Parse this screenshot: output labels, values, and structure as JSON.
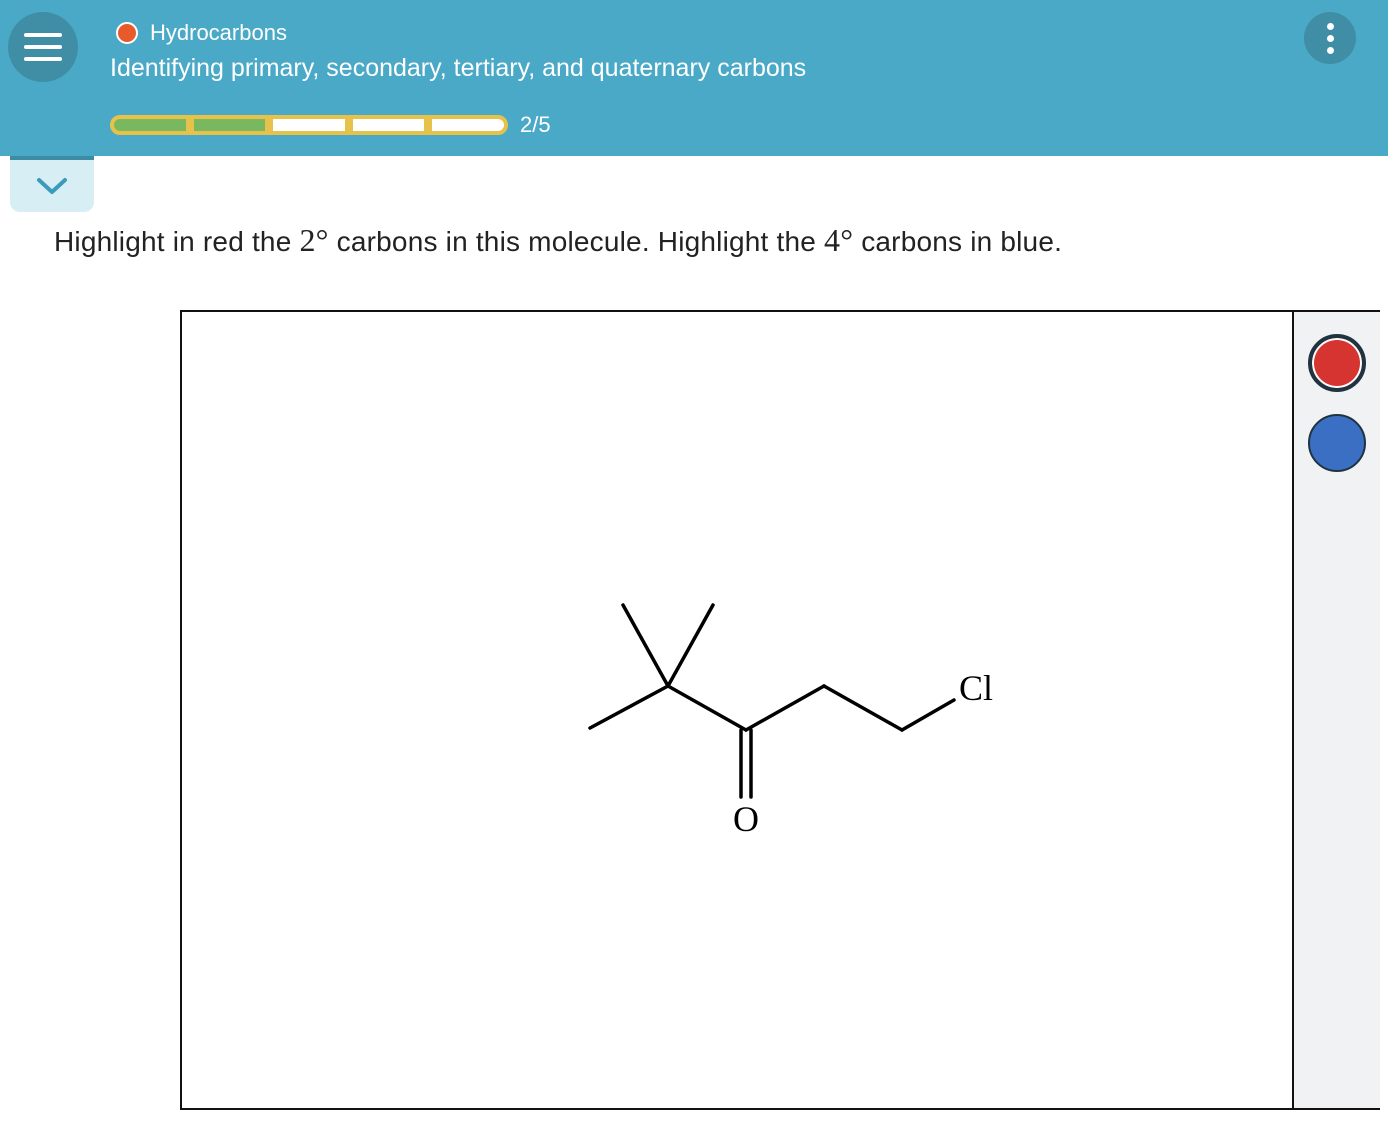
{
  "header": {
    "topic": "Hydrocarbons",
    "title": "Identifying primary, secondary, tertiary, and quaternary carbons",
    "progress": {
      "current": 2,
      "total": 5,
      "label": "2/5"
    }
  },
  "question": {
    "part1": "Highlight in red the ",
    "deg1": "2°",
    "part2": " carbons in this molecule. Highlight the ",
    "deg2": "4°",
    "part3": " carbons in blue."
  },
  "molecule": {
    "atom_cl": "Cl",
    "atom_o": "O"
  },
  "palette": [
    {
      "name": "red",
      "color": "#d63431",
      "selected": true
    },
    {
      "name": "blue",
      "color": "#3a6fc4",
      "selected": false
    }
  ],
  "colors": {
    "header": "#4aa9c6",
    "progress_done": "#7ab860",
    "progress_todo": "#ffffff",
    "progress_border": "#e6c24b",
    "topic_dot": "#e85a2c"
  }
}
